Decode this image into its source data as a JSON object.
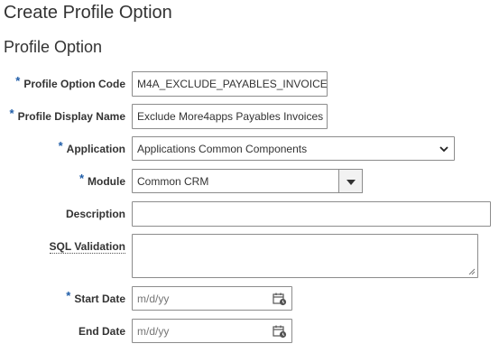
{
  "page": {
    "title": "Create Profile Option"
  },
  "section": {
    "title": "Profile Option"
  },
  "required_marker": "*",
  "fields": {
    "profile_option_code": {
      "label": "Profile Option Code",
      "value": "M4A_EXCLUDE_PAYABLES_INVOICE"
    },
    "profile_display_name": {
      "label": "Profile Display Name",
      "value": "Exclude More4apps Payables Invoices"
    },
    "application": {
      "label": "Application",
      "value": "Applications Common Components"
    },
    "module": {
      "label": "Module",
      "value": "Common CRM"
    },
    "description": {
      "label": "Description",
      "value": ""
    },
    "sql_validation": {
      "label": "SQL Validation",
      "value": ""
    },
    "start_date": {
      "label": "Start Date",
      "placeholder": "m/d/yy"
    },
    "end_date": {
      "label": "End Date",
      "placeholder": "m/d/yy"
    }
  },
  "icons": {
    "calendar": "calendar-icon",
    "dropdown": "chevron-down-icon",
    "combo": "triangle-down-icon"
  },
  "colors": {
    "required": "#1f5da8",
    "border": "#8c8c8c",
    "text": "#333333"
  }
}
